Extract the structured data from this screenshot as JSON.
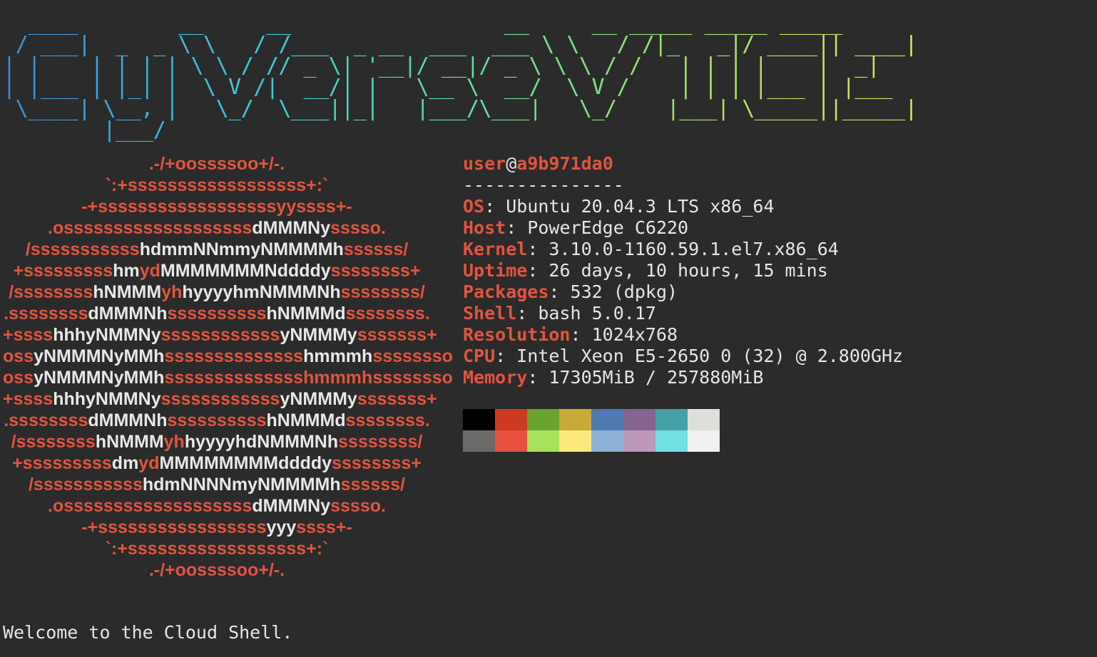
{
  "terminal": {
    "background": "#2b2b2b",
    "foreground": "#e6e6e6",
    "accent": "#e25440"
  },
  "banner": {
    "lines": [
      "  ____        __     __                 __     __ _____ _____ _____ ",
      " / ___|  _  _ \\ \\   / /___  _ __  ___  ___ \\ \\   / /|_   _|/ ____|| ____|",
      "| |    | | | | \\ \\ / // _ \\| '__|/ __|/ _ \\ \\ \\ / /   | | | |    |  _|  ",
      "| |___ | |_| |  \\ V /|  __/| |   \\__ \\  __/  \\ V /    | | | |___ | |___ ",
      " \\____| \\__, |   \\_/  \\___||_|   |___/\\___|   \\_/    |___| \\_____||_____|",
      "        |___/                                                          "
    ],
    "gradient_colors": [
      "#3a8fe0",
      "#3cc8e0",
      "#5ee0a0",
      "#a6e06a",
      "#e0e060"
    ]
  },
  "logo": {
    "lines": [
      [
        [
          "r",
          ".-/+oossssoo+/-."
        ]
      ],
      [
        [
          "r",
          "`:+ssssssssssssssssss+:`"
        ]
      ],
      [
        [
          "r",
          "-+ssssssssssssssssssyyssss+-"
        ]
      ],
      [
        [
          "r",
          ".osssssssssssssssssss"
        ],
        [
          "w",
          "dMMMNy"
        ],
        [
          "r",
          "sssso."
        ]
      ],
      [
        [
          "r",
          "/sssssssssss"
        ],
        [
          "w",
          "hdmmNNmmyNMMMMh"
        ],
        [
          "r",
          "ssssss/"
        ]
      ],
      [
        [
          "r",
          "+sssssssss"
        ],
        [
          "w",
          "hm"
        ],
        [
          "r",
          "yd"
        ],
        [
          "w",
          "MMMMMMMNddddy"
        ],
        [
          "r",
          "ssssssss+"
        ]
      ],
      [
        [
          "r",
          "/ssssssss"
        ],
        [
          "w",
          "hNMMM"
        ],
        [
          "r",
          "yh"
        ],
        [
          "w",
          "hyyyyhmNMMMNh"
        ],
        [
          "r",
          "ssssssss/"
        ]
      ],
      [
        [
          "r",
          ".ssssssss"
        ],
        [
          "w",
          "dMMMNh"
        ],
        [
          "r",
          "ssssssssss"
        ],
        [
          "w",
          "hNMMMd"
        ],
        [
          "r",
          "ssssssss."
        ]
      ],
      [
        [
          "r",
          "+ssss"
        ],
        [
          "w",
          "hhhyNMMNy"
        ],
        [
          "r",
          "ssssssssssss"
        ],
        [
          "w",
          "yNMMMy"
        ],
        [
          "r",
          "sssssss+"
        ]
      ],
      [
        [
          "r",
          "oss"
        ],
        [
          "w",
          "yNMMMNyMMh"
        ],
        [
          "r",
          "ssssssssssssss"
        ],
        [
          "w",
          "hmmmh"
        ],
        [
          "r",
          "ssssssso"
        ]
      ],
      [
        [
          "r",
          "oss"
        ],
        [
          "w",
          "yNMMMNyMMh"
        ],
        [
          "r",
          "sssssssssssssshmmmh"
        ],
        [
          "r",
          "ssssssso"
        ]
      ],
      [
        [
          "r",
          "+ssss"
        ],
        [
          "w",
          "hhhyNMMNy"
        ],
        [
          "r",
          "ssssssssssss"
        ],
        [
          "w",
          "yNMMMy"
        ],
        [
          "r",
          "sssssss+"
        ]
      ],
      [
        [
          "r",
          ".ssssssss"
        ],
        [
          "w",
          "dMMMNh"
        ],
        [
          "r",
          "ssssssssss"
        ],
        [
          "w",
          "hNMMMd"
        ],
        [
          "r",
          "ssssssss."
        ]
      ],
      [
        [
          "r",
          "/ssssssss"
        ],
        [
          "w",
          "hNMMM"
        ],
        [
          "r",
          "yh"
        ],
        [
          "w",
          "hyyyyhdNMMMNh"
        ],
        [
          "r",
          "ssssssss/"
        ]
      ],
      [
        [
          "r",
          "+sssssssss"
        ],
        [
          "w",
          "dm"
        ],
        [
          "r",
          "yd"
        ],
        [
          "w",
          "MMMMMMMMddddy"
        ],
        [
          "r",
          "ssssssss+"
        ]
      ],
      [
        [
          "r",
          "/sssssssssss"
        ],
        [
          "w",
          "hdmNNNNmyNMMMMh"
        ],
        [
          "r",
          "ssssss/"
        ]
      ],
      [
        [
          "r",
          ".osssssssssssssssssss"
        ],
        [
          "w",
          "dMMMNy"
        ],
        [
          "r",
          "sssso."
        ]
      ],
      [
        [
          "r",
          "-+sssssssssssssssss"
        ],
        [
          "w",
          "yyy"
        ],
        [
          "r",
          "ssss+-"
        ]
      ],
      [
        [
          "r",
          "`:+ssssssssssssssssss+:`"
        ]
      ],
      [
        [
          "r",
          ".-/+oossssoo+/-."
        ]
      ]
    ]
  },
  "info": {
    "user": "user",
    "at": "@",
    "host": "a9b971da0",
    "separator": "---------------",
    "fields": [
      {
        "key": "OS",
        "value": "Ubuntu 20.04.3 LTS x86_64"
      },
      {
        "key": "Host",
        "value": "PowerEdge C6220"
      },
      {
        "key": "Kernel",
        "value": "3.10.0-1160.59.1.el7.x86_64"
      },
      {
        "key": "Uptime",
        "value": "26 days, 10 hours, 15 mins"
      },
      {
        "key": "Packages",
        "value": "532 (dpkg)"
      },
      {
        "key": "Shell",
        "value": "bash 5.0.17"
      },
      {
        "key": "Resolution",
        "value": "1024x768"
      },
      {
        "key": "CPU",
        "value": "Intel Xeon E5-2650 0 (32) @ 2.800GHz"
      },
      {
        "key": "Memory",
        "value": "17305MiB / 257880MiB"
      }
    ],
    "colon": ": "
  },
  "palette": {
    "normal": [
      "#000000",
      "#cc3a22",
      "#6ba32d",
      "#c9aa39",
      "#4f79b0",
      "#83658e",
      "#44a1a7",
      "#dddfdb"
    ],
    "bright": [
      "#6a6b68",
      "#e6503e",
      "#a8e15a",
      "#fbe97c",
      "#8fb0d6",
      "#bc98ba",
      "#70e0e2",
      "#f1f2ef"
    ]
  },
  "welcome": "Welcome to the Cloud Shell."
}
